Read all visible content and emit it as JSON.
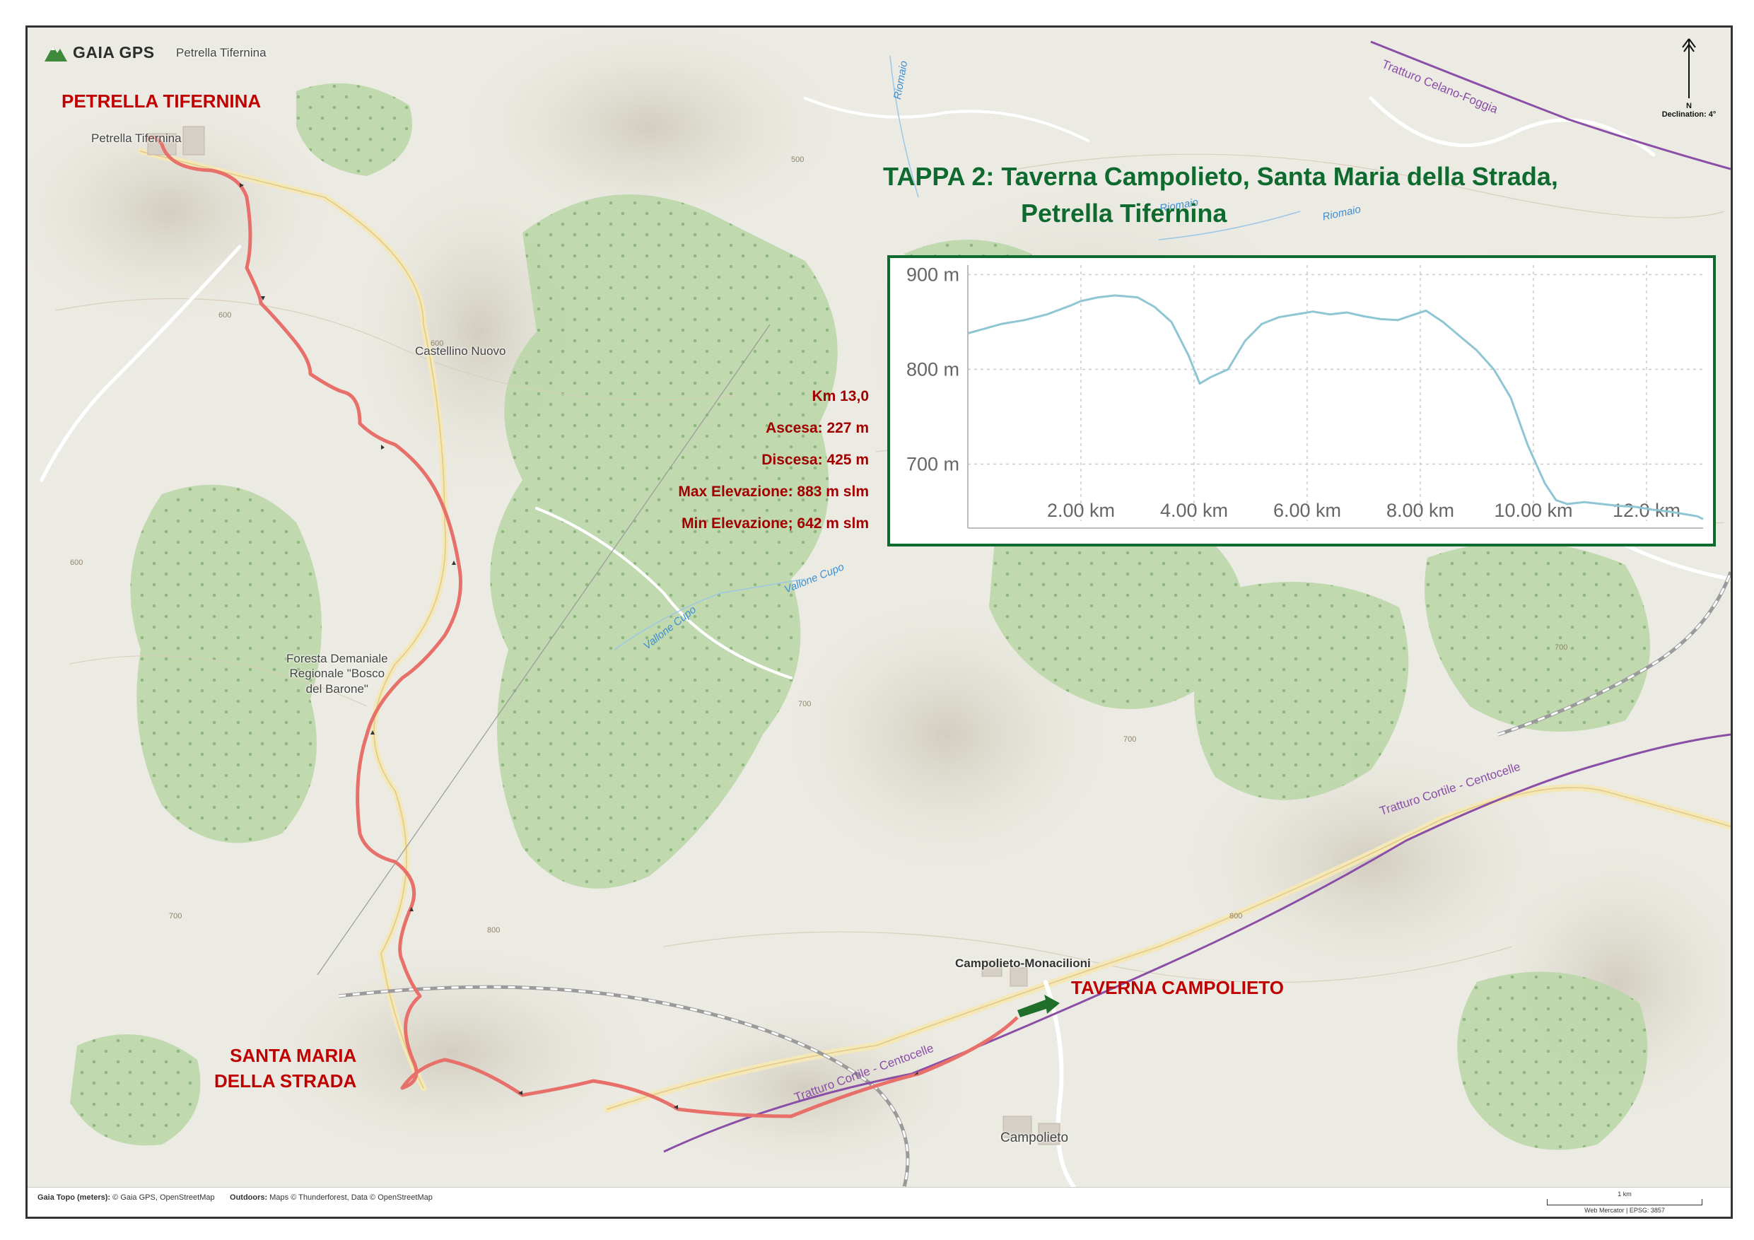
{
  "brand": {
    "name": "GAIA GPS"
  },
  "title": {
    "line1": "TAPPA 2: Taverna Campolieto, Santa Maria della Strada,",
    "line2": "Petrella Tifernina"
  },
  "stats": {
    "distance": "Km 13,0",
    "ascent": "Ascesa: 227 m",
    "descent": "Discesa: 425 m",
    "max_elevation": "Max Elevazione: 883 m slm",
    "min_elevation": "Min Elevazione; 642 m slm"
  },
  "route_labels": {
    "start": "TAVERNA CAMPOLIETO",
    "mid_line1": "SANTA MARIA",
    "mid_line2": "DELLA STRADA",
    "end": "PETRELLA TIFERNINA"
  },
  "map_places": {
    "petrella_top": "Petrella Tifernina",
    "petrella_town": "Petrella Tifernina",
    "castellino": "Castellino Nuovo",
    "foresta_1": "Foresta Demaniale",
    "foresta_2": "Regionale \"Bosco",
    "foresta_3": "del Barone\"",
    "campolieto_monacilioni": "Campolieto-Monacilioni",
    "campolieto": "Campolieto",
    "tratturo_celano": "Tratturo Celano-Foggia",
    "tratturo_cortile_1": "Tratturo Cortile - Centocelle",
    "tratturo_cortile_2": "Tratturo Cortile - Centocelle",
    "vallone_1": "Vallone Cupo",
    "vallone_2": "Vallone Cupo",
    "riomaio_1": "Riomaio",
    "riomaio_2": "Riomaio",
    "riomaio_3": "Riomaio"
  },
  "compass": {
    "north": "N",
    "declination": "Declination: 4°"
  },
  "footer": {
    "gaia_label": "Gaia Topo (meters):",
    "gaia_credit": "© Gaia GPS, OpenStreetMap",
    "outdoors_label": "Outdoors:",
    "outdoors_credit": "Maps © Thunderforest, Data © OpenStreetMap",
    "scale_label": "1 km",
    "projection": "Web Mercator | EPSG: 3857"
  },
  "colors": {
    "route": "#e8706b",
    "title_green": "#0e6a2e",
    "label_red": "#c00000",
    "profile_line": "#8fc6d4",
    "forest": "#b9d6a6",
    "tratturo": "#8a4ea6"
  },
  "chart_data": {
    "type": "line",
    "title": "",
    "xlabel": "",
    "ylabel": "",
    "x_unit": "km",
    "y_unit": "m",
    "xlim": [
      0,
      13
    ],
    "ylim": [
      640,
      910
    ],
    "x_ticks": [
      "2.00 km",
      "4.00 km",
      "6.00 km",
      "8.00 km",
      "10.00 km",
      "12.0 km"
    ],
    "y_ticks": [
      "700 m",
      "800 m",
      "900 m"
    ],
    "y_tick_values": [
      700,
      800,
      900
    ],
    "x_tick_values": [
      2,
      4,
      6,
      8,
      10,
      12
    ],
    "grid": true,
    "series": [
      {
        "x": [
          0,
          0.3,
          0.6,
          1.0,
          1.4,
          1.8,
          2.0,
          2.3,
          2.6,
          3.0,
          3.3,
          3.6,
          3.9,
          4.1,
          4.3,
          4.6,
          4.9,
          5.2,
          5.5,
          5.8,
          6.1,
          6.4,
          6.7,
          7.0,
          7.3,
          7.6,
          7.9,
          8.1,
          8.4,
          8.7,
          9.0,
          9.3,
          9.6,
          9.9,
          10.2,
          10.4,
          10.6,
          10.9,
          11.2,
          11.5,
          11.8,
          12.1,
          12.4,
          12.7,
          12.9,
          13.0
        ],
        "y": [
          838,
          843,
          848,
          852,
          858,
          867,
          872,
          876,
          878,
          876,
          866,
          850,
          815,
          785,
          792,
          800,
          830,
          848,
          855,
          858,
          861,
          858,
          860,
          856,
          853,
          852,
          858,
          862,
          850,
          835,
          820,
          800,
          770,
          720,
          680,
          662,
          658,
          660,
          658,
          656,
          655,
          652,
          650,
          647,
          645,
          642
        ]
      }
    ]
  }
}
